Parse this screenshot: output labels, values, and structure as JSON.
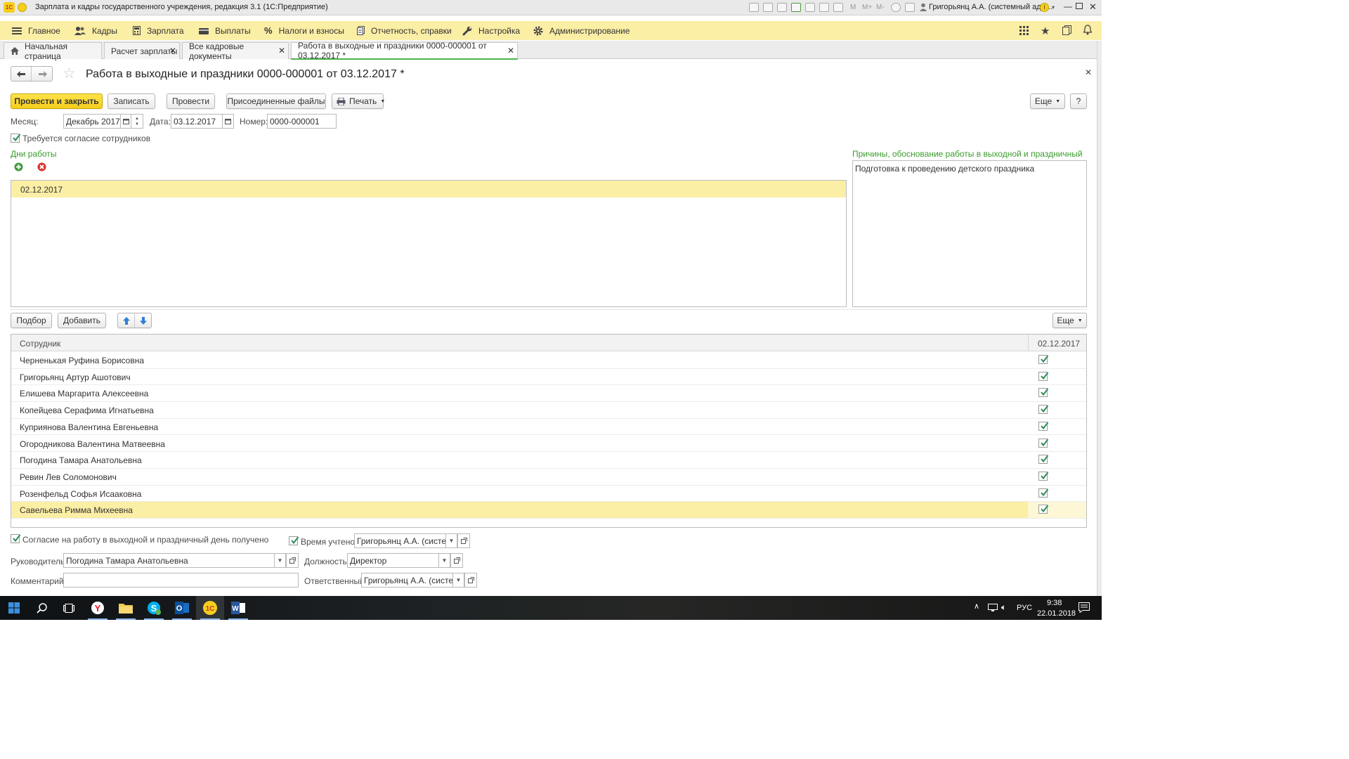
{
  "window": {
    "title": "Зарплата и кадры государственного учреждения, редакция 3.1  (1С:Предприятие)",
    "user": "Григорьянц А.А. (системный адм..."
  },
  "sections": [
    "Главное",
    "Кадры",
    "Зарплата",
    "Выплаты",
    "Налоги и взносы",
    "Отчетность, справки",
    "Настройка",
    "Администрирование"
  ],
  "tabs": [
    {
      "label": "Начальная страница"
    },
    {
      "label": "Расчет зарплаты"
    },
    {
      "label": "Все кадровые документы"
    },
    {
      "label": "Работа в выходные и праздники 0000-000001 от 03.12.2017 *"
    }
  ],
  "doc": {
    "title": "Работа в выходные и праздники 0000-000001 от 03.12.2017 *"
  },
  "toolbar": {
    "post_close": "Провести и закрыть",
    "save": "Записать",
    "post": "Провести",
    "files": "Присоединенные файлы",
    "print": "Печать",
    "more": "Еще",
    "help": "?"
  },
  "form": {
    "month_label": "Месяц:",
    "month_value": "Декабрь 2017",
    "date_label": "Дата:",
    "date_value": "03.12.2017",
    "number_label": "Номер:",
    "number_value": "0000-000001",
    "consent_required_label": "Требуется согласие сотрудников",
    "consent_required_checked": true,
    "days_label": "Дни работы",
    "reason_label": "Причины, обоснование работы в выходной и праздничный день",
    "reason_value": "Подготовка к проведению детского праздника"
  },
  "work_days": [
    "02.12.2017"
  ],
  "table_toolbar": {
    "pick": "Подбор",
    "add": "Добавить",
    "more": "Еще"
  },
  "employees_table": {
    "col_employee": "Сотрудник",
    "col_date": "02.12.2017",
    "rows": [
      {
        "name": "Черненькая Руфина Борисовна",
        "checked": true
      },
      {
        "name": "Григорьянц Артур Ашотович",
        "checked": true
      },
      {
        "name": "Елишева Маргарита Алексеевна",
        "checked": true
      },
      {
        "name": "Копейцева Серафима Игнатьевна",
        "checked": true
      },
      {
        "name": "Куприянова Валентина Евгеньевна",
        "checked": true
      },
      {
        "name": "Огородникова Валентина Матвеевна",
        "checked": true
      },
      {
        "name": "Погодина Тамара Анатольевна",
        "checked": true
      },
      {
        "name": "Ревин Лев Соломонович",
        "checked": true
      },
      {
        "name": "Розенфельд Софья Исааковна",
        "checked": true
      },
      {
        "name": "Савельева Римма Михеевна",
        "checked": true
      }
    ],
    "selected_row": 9
  },
  "footer": {
    "consent_received_label": "Согласие на работу в выходной и праздничный день получено",
    "time_accounted_label": "Время учтено",
    "time_accounted_value": "Григорьянц А.А. (системн",
    "manager_label": "Руководитель:",
    "manager_value": "Погодина Тамара Анатольевна",
    "position_label": "Должность:",
    "position_value": "Директор",
    "comment_label": "Комментарий:",
    "comment_value": "",
    "responsible_label": "Ответственный:",
    "responsible_value": "Григорьянц А.А. (системн"
  },
  "taskbar": {
    "lang": "РУС",
    "time": "9:38",
    "date": "22.01.2018"
  },
  "colors": {
    "accent_yellow": "#fbeea5",
    "primary_button": "#f6cf1b",
    "label_green": "#3a9a2c",
    "check_green": "#2e8b57"
  }
}
